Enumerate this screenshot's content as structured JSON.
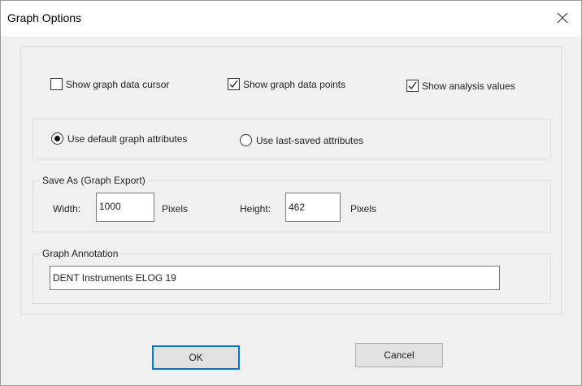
{
  "window": {
    "title": "Graph Options",
    "close_icon": "close-icon"
  },
  "options": {
    "show_cursor": {
      "label": "Show graph data cursor",
      "checked": false
    },
    "show_points": {
      "label": "Show graph data points",
      "checked": true
    },
    "show_analysis": {
      "label": "Show analysis values",
      "checked": true
    }
  },
  "attributes": {
    "default": {
      "label": "Use default graph attributes",
      "selected": true
    },
    "last_saved": {
      "label": "Use last-saved attributes",
      "selected": false
    }
  },
  "export": {
    "legend": "Save As (Graph Export)",
    "width_label": "Width:",
    "width_value": "1000",
    "width_unit": "Pixels",
    "height_label": "Height:",
    "height_value": "462",
    "height_unit": "Pixels"
  },
  "annotation": {
    "legend": "Graph Annotation",
    "value": "DENT Instruments ELOG 19"
  },
  "buttons": {
    "ok": "OK",
    "cancel": "Cancel"
  },
  "colors": {
    "accent": "#0078d7",
    "dialog_bg": "#f0f0f0"
  }
}
